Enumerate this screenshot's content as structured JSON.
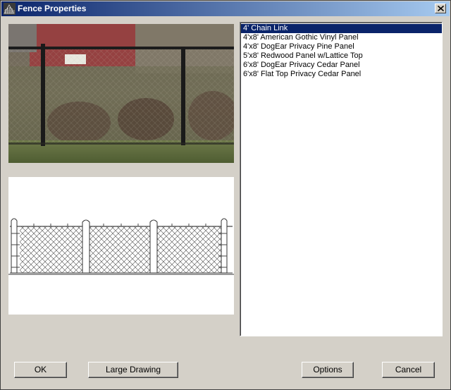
{
  "window": {
    "title": "Fence Properties",
    "icon": "fence-app-icon"
  },
  "fence_list": {
    "items": [
      "4' Chain Link",
      "4'x8' American Gothic Vinyl Panel",
      "4'x8' DogEar Privacy Pine Panel",
      "5'x8' Redwood Panel w/Lattice Top",
      "6'x8' DogEar Privacy Cedar Panel",
      "6'x8' Flat Top Privacy Cedar Panel"
    ],
    "selected": "4' Chain Link"
  },
  "buttons": {
    "ok": "OK",
    "large_drawing": "Large Drawing",
    "options": "Options",
    "cancel": "Cancel"
  },
  "colors": {
    "titlebar_start": "#0a246a",
    "titlebar_end": "#a6caf0",
    "selection": "#0a246a",
    "dialog_bg": "#d4d0c8"
  }
}
